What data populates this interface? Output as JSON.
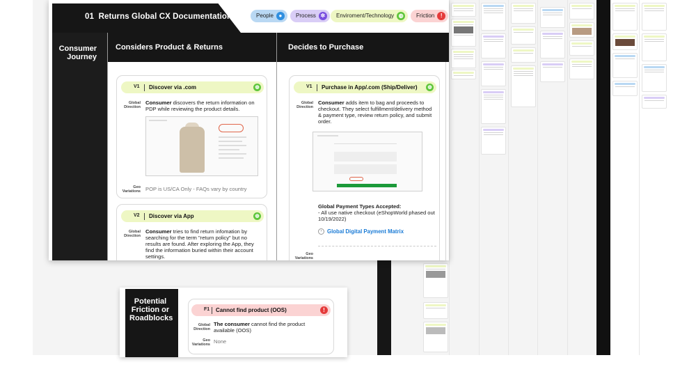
{
  "header": {
    "number": "01",
    "title": "Returns Global CX Documentation"
  },
  "legend": [
    {
      "label": "People",
      "color": "#b9d8f3",
      "dot_color": "#2f8fe0",
      "icon": "person-icon"
    },
    {
      "label": "Process",
      "color": "#d9cdf6",
      "dot_color": "#7a4fe0",
      "icon": "gear-icon"
    },
    {
      "label": "Enviroment/Technology",
      "color": "#eef7c4",
      "dot_color": "#5fc63b",
      "icon": "globe-icon"
    },
    {
      "label": "Friction",
      "color": "#fbd3d3",
      "dot_color": "#e53b3b",
      "icon": "alert-icon"
    }
  ],
  "rows": {
    "journey": "Consumer Journey",
    "friction": "Potential Friction or Roadblocks"
  },
  "columns": [
    {
      "title": "Considers Product & Returns"
    },
    {
      "title": "Decides to Purchase"
    }
  ],
  "labels": {
    "global_direction": "Global Direction",
    "geo_variations": "Geo Variations"
  },
  "cards": {
    "discover_com": {
      "code": "V1",
      "title": "Discover via .com",
      "actor": "Consumer",
      "text": " discovers the return information on PDP while reviewing the product details.",
      "geo": "POP is US/CA Only - FAQs vary by country"
    },
    "discover_app": {
      "code": "V2",
      "title": "Discover via App",
      "actor": "Consumer",
      "text": " tries to find return infomation by searching for the term \"return policy\" but no results are found. After exploring the App, they find the information buried within their account settings."
    },
    "purchase": {
      "code": "V1",
      "title": "Purchase in App/.com (Ship/Deliver)",
      "actor": "Consumer",
      "text": " adds item to bag and proceeds to checkout. They select fulfillment/delivery method & payment type, review return policy, and submit order.",
      "payment_heading": "Global Payment Types Accepted:",
      "payment_text": "- All use native checkout (eShopWorld phased out 10/19/2022)",
      "link": "Global Digital Payment Matrix"
    },
    "friction": {
      "code": "F1",
      "title": "Cannot find product (OOS)",
      "actor": "The consumer",
      "text": " cannot find the product available (OOS)",
      "geo": "None"
    }
  }
}
